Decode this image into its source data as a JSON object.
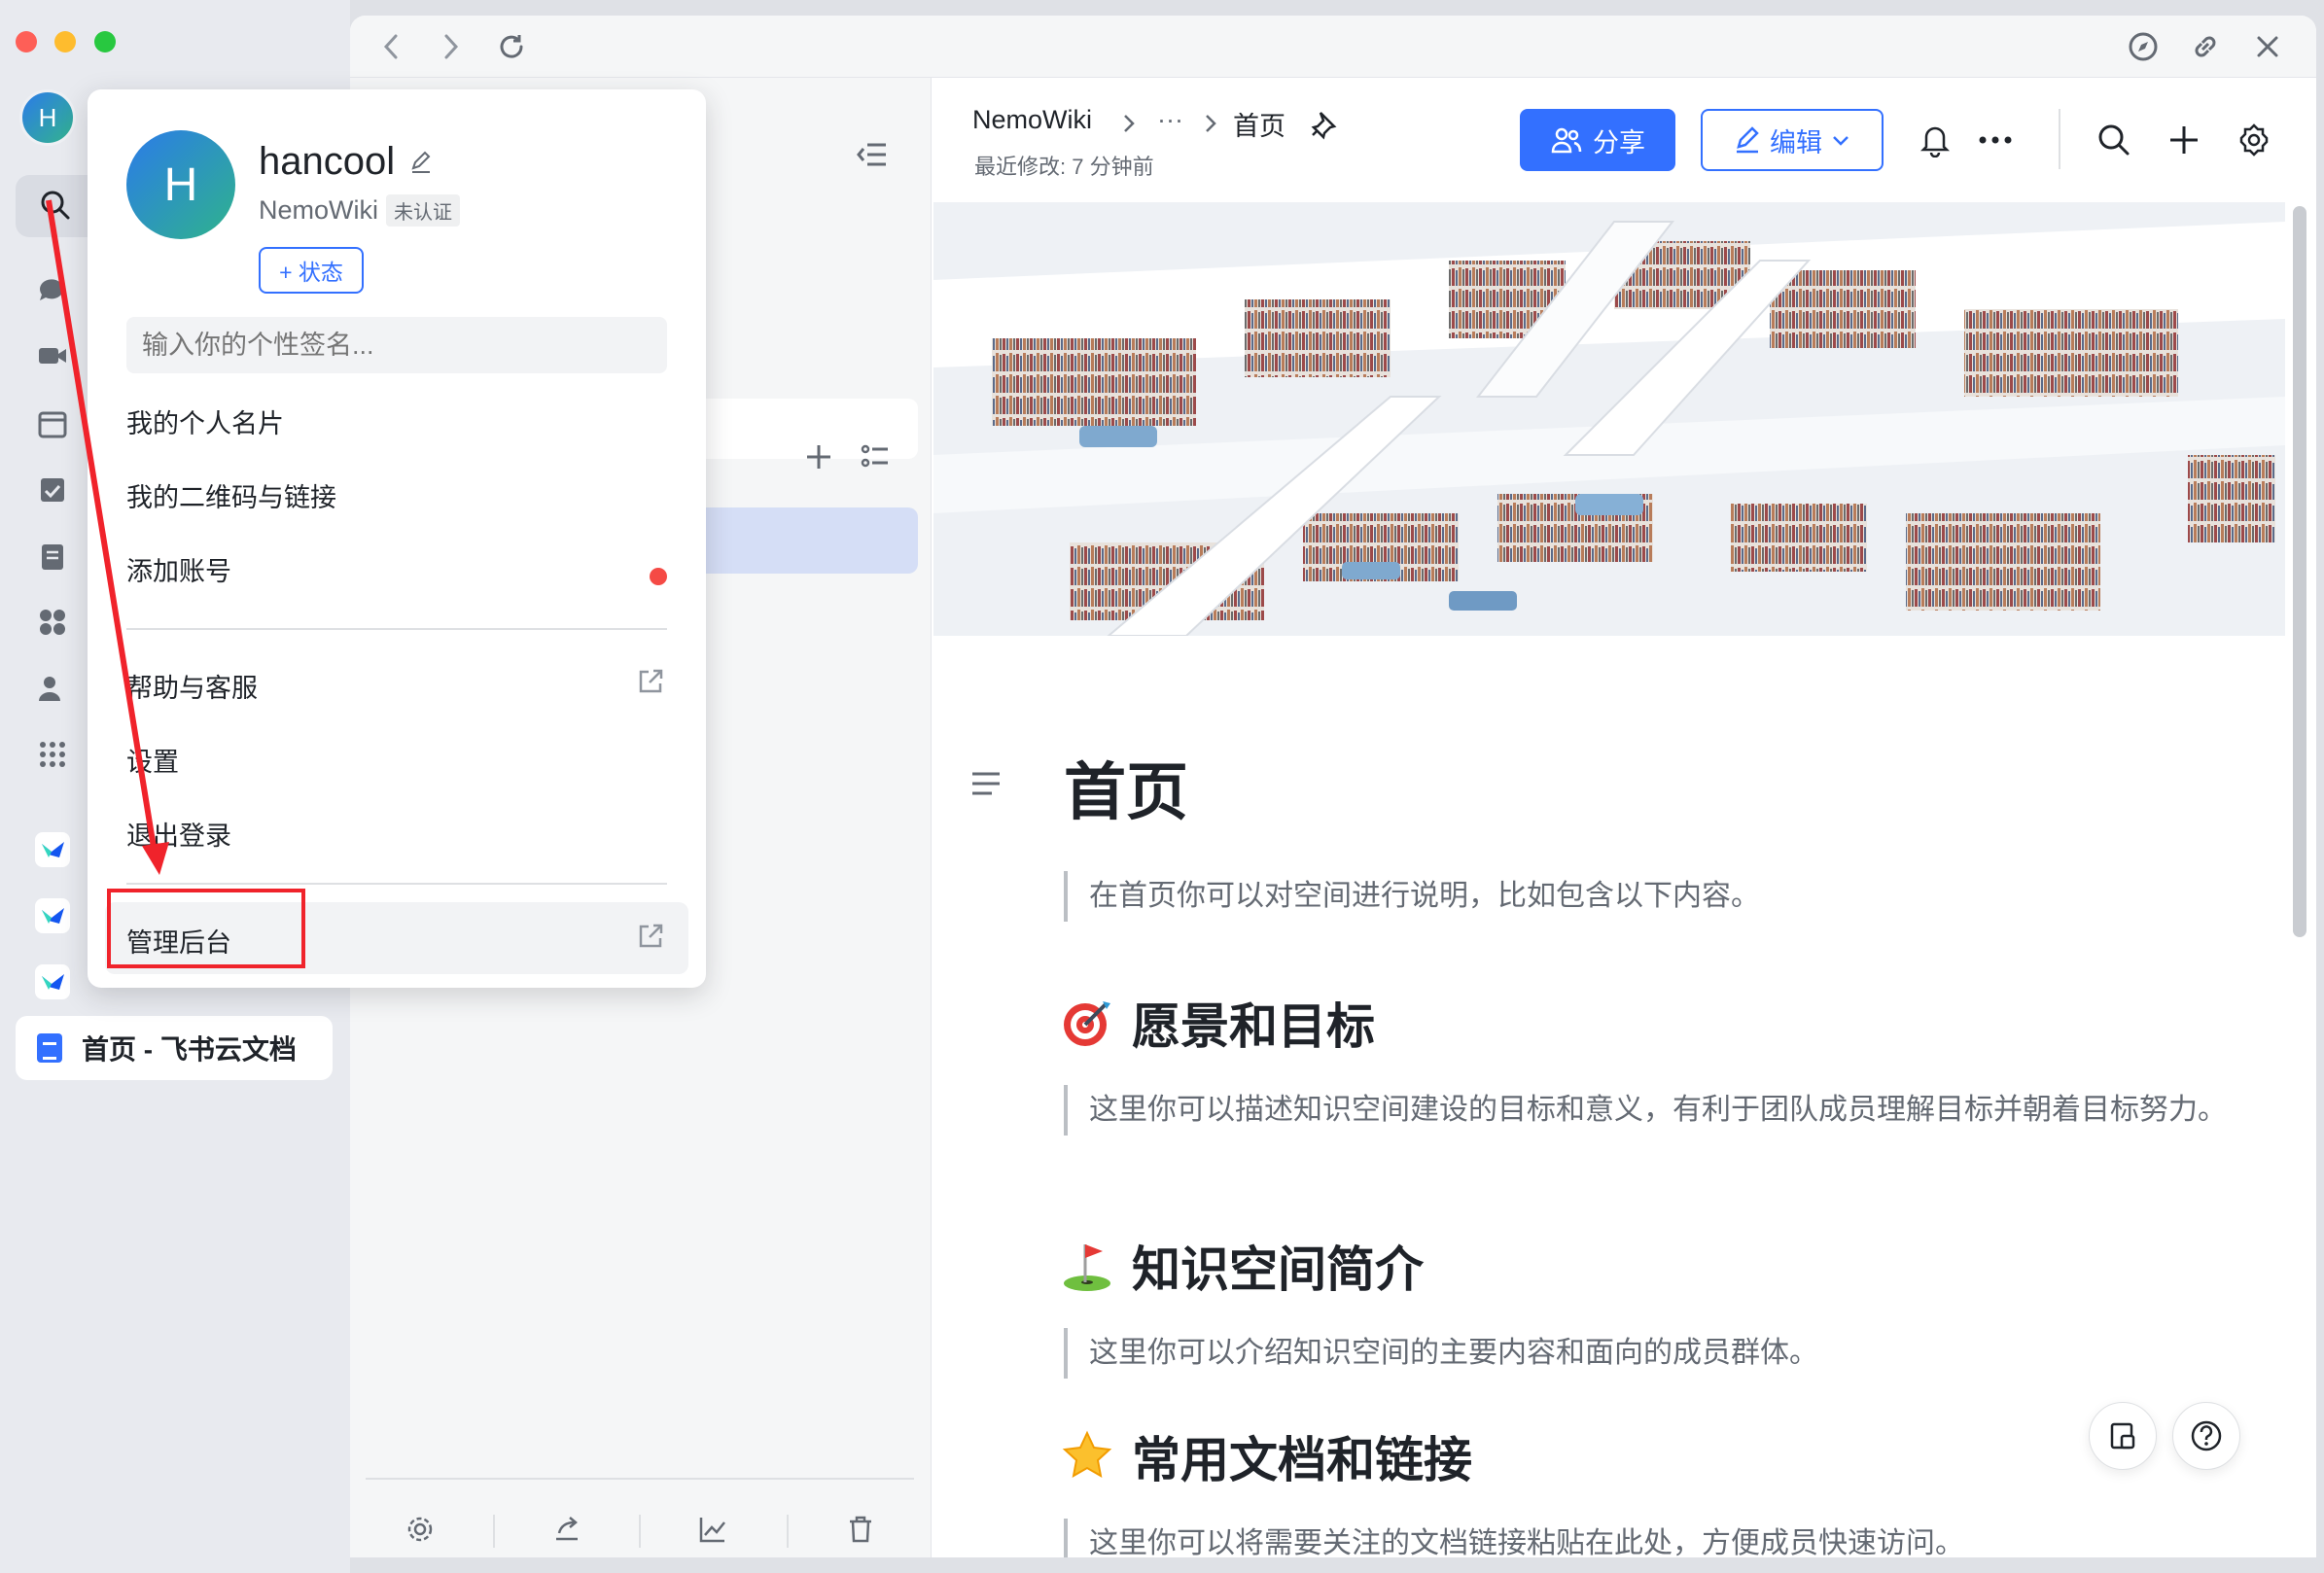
{
  "rail": {
    "avatar_letter": "H",
    "selected_doc_label": "首页 - 飞书云文档"
  },
  "breadcrumb": {
    "root": "NemoWiki",
    "ellipsis": "···",
    "current": "首页"
  },
  "doc_meta": {
    "last_modified": "最近修改: 7 分钟前"
  },
  "toolbar": {
    "share_label": "分享",
    "edit_label": "编辑"
  },
  "document": {
    "title": "首页",
    "intro": "在首页你可以对空间进行说明，比如包含以下内容。",
    "sections": [
      {
        "heading": "愿景和目标",
        "emoji": "target-emoji",
        "body": "这里你可以描述知识空间建设的目标和意义，有利于团队成员理解目标并朝着目标努力。"
      },
      {
        "heading": "知识空间简介",
        "emoji": "golf-flag-emoji",
        "body": "这里你可以介绍知识空间的主要内容和面向的成员群体。"
      },
      {
        "heading": "常用文档和链接",
        "emoji": "star-emoji",
        "body": "这里你可以将需要关注的文档链接粘贴在此处，方便成员快速访问。"
      }
    ]
  },
  "profile_menu": {
    "avatar_letter": "H",
    "username": "hancool",
    "org": "NemoWiki",
    "org_badge": "未认证",
    "status_button": "+ 状态",
    "signature_placeholder": "输入你的个性签名...",
    "items": {
      "business_card": "我的个人名片",
      "qr_link": "我的二维码与链接",
      "add_account": "添加账号",
      "help": "帮助与客服",
      "settings": "设置",
      "logout": "退出登录",
      "admin": "管理后台"
    }
  },
  "colors": {
    "primary": "#3370ff",
    "annotation_red": "#f0232b",
    "notification_dot": "#f54a45"
  }
}
